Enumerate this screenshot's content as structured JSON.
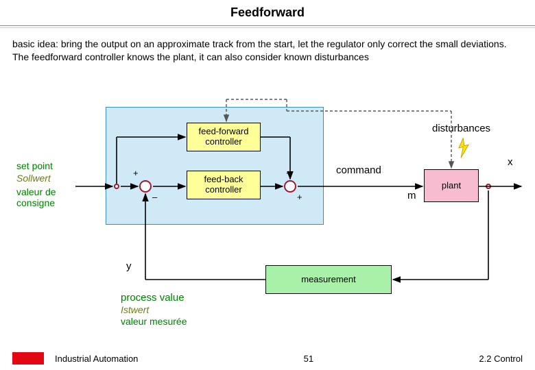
{
  "title": "Feedforward",
  "intro": "basic idea: bring the output on an approximate track from the start, let the regulator only correct the small deviations. The feedforward controller knows the plant, it can also consider known disturbances",
  "labels": {
    "setpoint_en": "set point",
    "setpoint_de": "Sollwert",
    "setpoint_fr": "valeur de consigne",
    "ffc": "feed-forward controller",
    "fbc": "feed-back controller",
    "disturbances": "disturbances",
    "command": "command",
    "plant": "plant",
    "x": "x",
    "m": "m",
    "y": "y",
    "measurement": "measurement",
    "process_value": "process value",
    "istwert": "Istwert",
    "valeur_mesuree": "valeur mesurée",
    "plus": "+",
    "minus": "–"
  },
  "footer": {
    "course": "Industrial Automation",
    "page": "51",
    "section": "2.2 Control"
  }
}
